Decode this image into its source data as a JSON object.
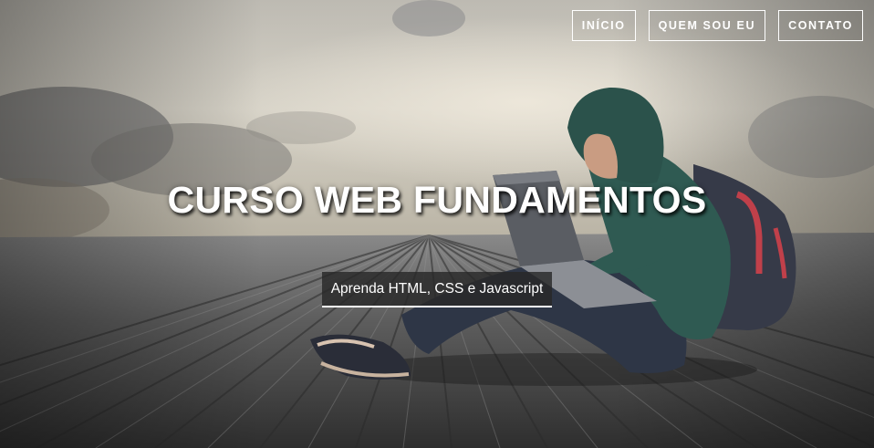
{
  "nav": {
    "items": [
      {
        "label": "INÍCIO"
      },
      {
        "label": "QUEM SOU EU"
      },
      {
        "label": "CONTATO"
      }
    ]
  },
  "hero": {
    "title": "CURSO WEB FUNDAMENTOS",
    "subtitle": "Aprenda HTML, CSS e Javascript"
  },
  "colors": {
    "text": "#ffffff",
    "subtitle_bg": "#2a2a2a",
    "sky": "#c9c6bd",
    "deck": "#5a5a5a",
    "hoodie": "#2f5a52",
    "backpack": "#3a3a48",
    "backpack_strap": "#c0404a"
  }
}
